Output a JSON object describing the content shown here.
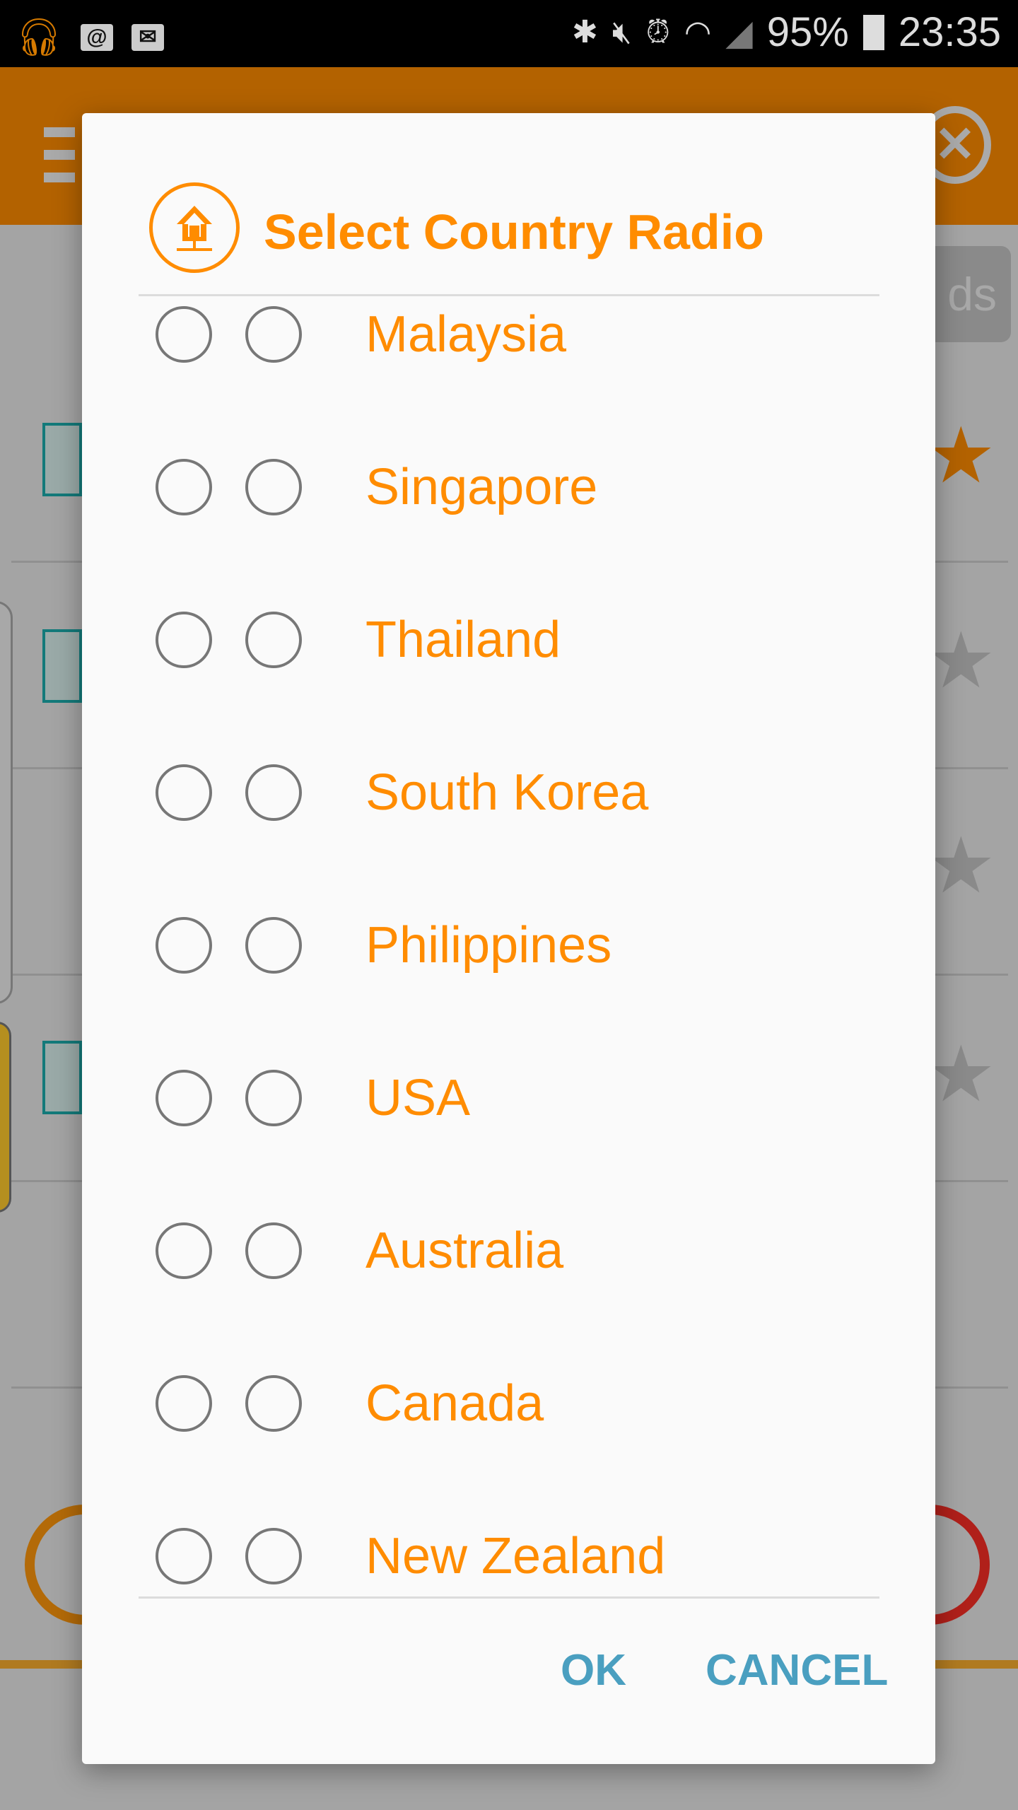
{
  "status_bar": {
    "battery": "95%",
    "time": "23:35",
    "left_icons": [
      "headphones-icon",
      "email-at-icon",
      "mail-icon"
    ],
    "right_icons": [
      "bluetooth-icon",
      "mute-icon",
      "alarm-icon",
      "wifi-icon",
      "signal-icon",
      "battery-charging-icon"
    ]
  },
  "background": {
    "button_partial_label": "ds"
  },
  "dialog": {
    "title": "Select Country Radio",
    "title_icon": "home-network-icon",
    "countries": [
      {
        "label": "Malaysia"
      },
      {
        "label": "Singapore"
      },
      {
        "label": "Thailand"
      },
      {
        "label": "South Korea"
      },
      {
        "label": "Philippines"
      },
      {
        "label": "USA"
      },
      {
        "label": "Australia"
      },
      {
        "label": "Canada"
      },
      {
        "label": "New Zealand"
      }
    ],
    "ok_label": "OK",
    "cancel_label": "CANCEL"
  },
  "colors": {
    "accent": "#ff8c00",
    "button": "#4a9fc0",
    "appbar": "#b36200"
  }
}
